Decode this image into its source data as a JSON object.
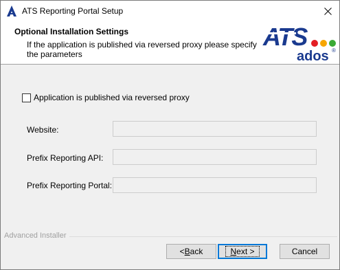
{
  "window": {
    "title": "ATS Reporting Portal Setup"
  },
  "header": {
    "title": "Optional Installation Settings",
    "subtitle": "If the application is published via reversed proxy please specify the parameters"
  },
  "logo": {
    "primary_text": "ATS",
    "secondary_text": "ados",
    "registered_mark": "®",
    "dot_colors": [
      "#e31e24",
      "#f7a600",
      "#3aaa35"
    ],
    "brand_color": "#1a3a8f"
  },
  "form": {
    "reverse_proxy_checkbox": {
      "label": "Application is published via reversed proxy",
      "checked": false
    },
    "fields": [
      {
        "label": "Website:",
        "value": "",
        "enabled": false
      },
      {
        "label": "Prefix Reporting API:",
        "value": "",
        "enabled": false
      },
      {
        "label": "Prefix Reporting Portal:",
        "value": "",
        "enabled": false
      }
    ]
  },
  "footer": {
    "branding": "Advanced Installer",
    "back_label_pre": "< ",
    "back_label_access": "B",
    "back_label_post": "ack",
    "next_label_access": "N",
    "next_label_post": "ext >",
    "cancel_label": "Cancel"
  }
}
